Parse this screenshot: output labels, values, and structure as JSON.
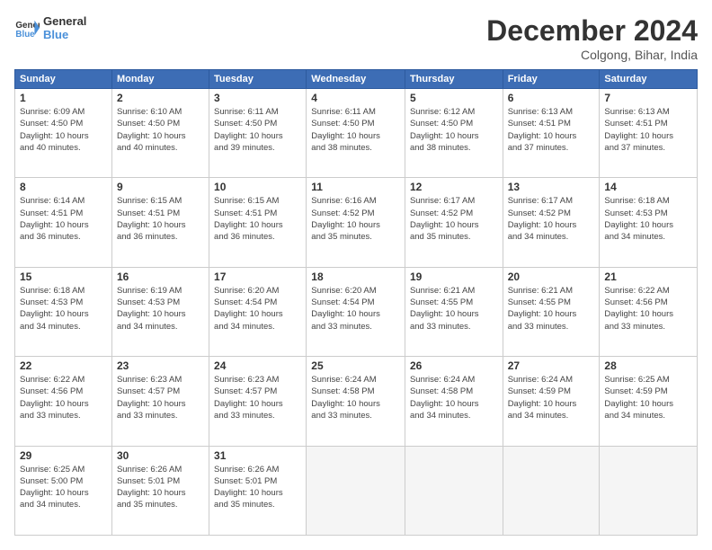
{
  "logo": {
    "line1": "General",
    "line2": "Blue"
  },
  "title": "December 2024",
  "location": "Colgong, Bihar, India",
  "days_header": [
    "Sunday",
    "Monday",
    "Tuesday",
    "Wednesday",
    "Thursday",
    "Friday",
    "Saturday"
  ],
  "weeks": [
    [
      {
        "day": "1",
        "info": "Sunrise: 6:09 AM\nSunset: 4:50 PM\nDaylight: 10 hours\nand 40 minutes."
      },
      {
        "day": "2",
        "info": "Sunrise: 6:10 AM\nSunset: 4:50 PM\nDaylight: 10 hours\nand 40 minutes."
      },
      {
        "day": "3",
        "info": "Sunrise: 6:11 AM\nSunset: 4:50 PM\nDaylight: 10 hours\nand 39 minutes."
      },
      {
        "day": "4",
        "info": "Sunrise: 6:11 AM\nSunset: 4:50 PM\nDaylight: 10 hours\nand 38 minutes."
      },
      {
        "day": "5",
        "info": "Sunrise: 6:12 AM\nSunset: 4:50 PM\nDaylight: 10 hours\nand 38 minutes."
      },
      {
        "day": "6",
        "info": "Sunrise: 6:13 AM\nSunset: 4:51 PM\nDaylight: 10 hours\nand 37 minutes."
      },
      {
        "day": "7",
        "info": "Sunrise: 6:13 AM\nSunset: 4:51 PM\nDaylight: 10 hours\nand 37 minutes."
      }
    ],
    [
      {
        "day": "8",
        "info": "Sunrise: 6:14 AM\nSunset: 4:51 PM\nDaylight: 10 hours\nand 36 minutes."
      },
      {
        "day": "9",
        "info": "Sunrise: 6:15 AM\nSunset: 4:51 PM\nDaylight: 10 hours\nand 36 minutes."
      },
      {
        "day": "10",
        "info": "Sunrise: 6:15 AM\nSunset: 4:51 PM\nDaylight: 10 hours\nand 36 minutes."
      },
      {
        "day": "11",
        "info": "Sunrise: 6:16 AM\nSunset: 4:52 PM\nDaylight: 10 hours\nand 35 minutes."
      },
      {
        "day": "12",
        "info": "Sunrise: 6:17 AM\nSunset: 4:52 PM\nDaylight: 10 hours\nand 35 minutes."
      },
      {
        "day": "13",
        "info": "Sunrise: 6:17 AM\nSunset: 4:52 PM\nDaylight: 10 hours\nand 34 minutes."
      },
      {
        "day": "14",
        "info": "Sunrise: 6:18 AM\nSunset: 4:53 PM\nDaylight: 10 hours\nand 34 minutes."
      }
    ],
    [
      {
        "day": "15",
        "info": "Sunrise: 6:18 AM\nSunset: 4:53 PM\nDaylight: 10 hours\nand 34 minutes."
      },
      {
        "day": "16",
        "info": "Sunrise: 6:19 AM\nSunset: 4:53 PM\nDaylight: 10 hours\nand 34 minutes."
      },
      {
        "day": "17",
        "info": "Sunrise: 6:20 AM\nSunset: 4:54 PM\nDaylight: 10 hours\nand 34 minutes."
      },
      {
        "day": "18",
        "info": "Sunrise: 6:20 AM\nSunset: 4:54 PM\nDaylight: 10 hours\nand 33 minutes."
      },
      {
        "day": "19",
        "info": "Sunrise: 6:21 AM\nSunset: 4:55 PM\nDaylight: 10 hours\nand 33 minutes."
      },
      {
        "day": "20",
        "info": "Sunrise: 6:21 AM\nSunset: 4:55 PM\nDaylight: 10 hours\nand 33 minutes."
      },
      {
        "day": "21",
        "info": "Sunrise: 6:22 AM\nSunset: 4:56 PM\nDaylight: 10 hours\nand 33 minutes."
      }
    ],
    [
      {
        "day": "22",
        "info": "Sunrise: 6:22 AM\nSunset: 4:56 PM\nDaylight: 10 hours\nand 33 minutes."
      },
      {
        "day": "23",
        "info": "Sunrise: 6:23 AM\nSunset: 4:57 PM\nDaylight: 10 hours\nand 33 minutes."
      },
      {
        "day": "24",
        "info": "Sunrise: 6:23 AM\nSunset: 4:57 PM\nDaylight: 10 hours\nand 33 minutes."
      },
      {
        "day": "25",
        "info": "Sunrise: 6:24 AM\nSunset: 4:58 PM\nDaylight: 10 hours\nand 33 minutes."
      },
      {
        "day": "26",
        "info": "Sunrise: 6:24 AM\nSunset: 4:58 PM\nDaylight: 10 hours\nand 34 minutes."
      },
      {
        "day": "27",
        "info": "Sunrise: 6:24 AM\nSunset: 4:59 PM\nDaylight: 10 hours\nand 34 minutes."
      },
      {
        "day": "28",
        "info": "Sunrise: 6:25 AM\nSunset: 4:59 PM\nDaylight: 10 hours\nand 34 minutes."
      }
    ],
    [
      {
        "day": "29",
        "info": "Sunrise: 6:25 AM\nSunset: 5:00 PM\nDaylight: 10 hours\nand 34 minutes."
      },
      {
        "day": "30",
        "info": "Sunrise: 6:26 AM\nSunset: 5:01 PM\nDaylight: 10 hours\nand 35 minutes."
      },
      {
        "day": "31",
        "info": "Sunrise: 6:26 AM\nSunset: 5:01 PM\nDaylight: 10 hours\nand 35 minutes."
      },
      null,
      null,
      null,
      null
    ]
  ]
}
